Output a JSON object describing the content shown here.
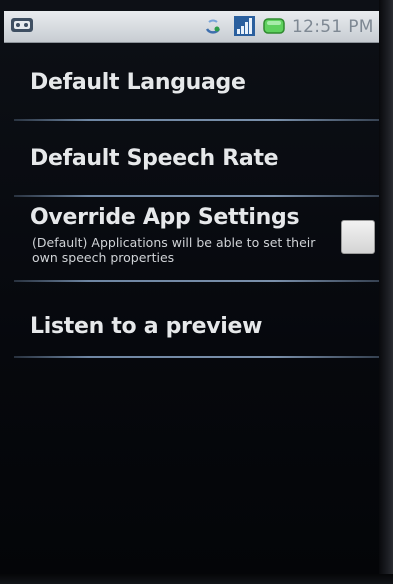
{
  "status_bar": {
    "time": "12:51 PM",
    "icons": [
      "notification-icon",
      "sync-icon",
      "signal-icon",
      "battery-icon"
    ]
  },
  "settings": {
    "items": [
      {
        "title": "Default Language"
      },
      {
        "title": "Default Speech Rate"
      },
      {
        "title": "Override App Settings",
        "summary": "(Default) Applications will be able to set their own speech properties",
        "checked": false
      },
      {
        "title": "Listen to a preview"
      }
    ]
  },
  "colors": {
    "background": "#06080d",
    "text": "#e6e8ea",
    "divider": "#7a90ab",
    "status_bar": "#d8dce0",
    "battery_green": "#5fd15f",
    "signal_blue": "#3e78b8"
  }
}
